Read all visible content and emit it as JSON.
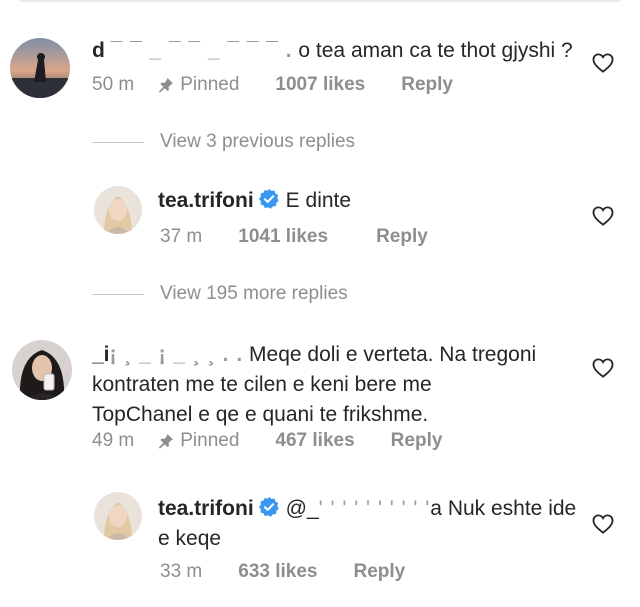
{
  "comments": [
    {
      "user_prefix": "d",
      "user_redacted": "¯ ¯ _ ¯ ¯ _ ¯ ¯ ¯ .",
      "user_suffix": "",
      "text": "o tea aman ca te thot gjyshi ?",
      "time": "50 m",
      "pinned": "Pinned",
      "likes": "1007 likes",
      "reply": "Reply"
    },
    {
      "username": "tea.trifoni",
      "verified": true,
      "text": "E dinte",
      "time": "37 m",
      "likes": "1041 likes",
      "reply": "Reply"
    },
    {
      "user_prefix": "_i",
      "user_redacted": "¡ ¸ _ ¡ _ ¸ ¸ . .",
      "user_suffix": "",
      "text_line1": "Meqe doli e verteta. Na tregoni",
      "text_line2": "kontraten me te cilen e keni bere me",
      "text_line3": "TopChanel e qe e quani te frikshme.",
      "time": "49 m",
      "pinned": "Pinned",
      "likes": "467 likes",
      "reply": "Reply"
    },
    {
      "username": "tea.trifoni",
      "verified": true,
      "mention_prefix": "@_",
      "mention_redacted": "' ' ' ' ' ' ' ' ' '",
      "mention_suffix": "a",
      "text_line1": "Nuk eshte ide",
      "text_line2": "e keqe",
      "time": "33 m",
      "likes": "633 likes",
      "reply": "Reply"
    }
  ],
  "view_previous": "View 3 previous replies",
  "view_more": "View 195 more replies",
  "colors": {
    "text": "#262626",
    "meta": "#8e8e8e",
    "verified": "#3897f0"
  },
  "icons": [
    "pin-icon",
    "heart-icon",
    "verified-badge-icon"
  ]
}
